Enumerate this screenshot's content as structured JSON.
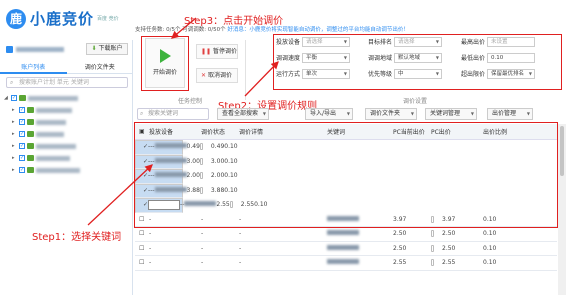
{
  "app": {
    "name": "小鹿竞价",
    "sub": "百度\n竞价"
  },
  "sidebar": {
    "download_btn": "下载账户",
    "tabs": [
      "账户列表",
      "调价文件夹"
    ],
    "search_placeholder": "搜索账户计划 单元 关键词",
    "tree_count": 6
  },
  "ribbon": {
    "hint_prefix": "支持任务数: 0/5个  可调调数: 0/50个",
    "hint_blue": "好消息：小鹿竞价将实现智能自动调价，调整过的平台均能自动调节出价！",
    "start_label": "开始调价",
    "pause_label": "暂停调价",
    "cancel_label": "取消调价",
    "section1": "任务控制",
    "section2": "调价设置",
    "settings": {
      "device": {
        "label": "投放设备",
        "value": "请选择"
      },
      "target_rank": {
        "label": "目标排名",
        "value": "请选择"
      },
      "max_price": {
        "label": "最高出价",
        "value": "未设置"
      },
      "speed": {
        "label": "调调速度",
        "value": "平衡"
      },
      "region": {
        "label": "调调地域",
        "value": "默认地域"
      },
      "min_price": {
        "label": "最低出价",
        "value": "0.10"
      },
      "mode": {
        "label": "运行方式",
        "value": "单次"
      },
      "priority": {
        "label": "优先等级",
        "value": "中"
      },
      "over_price": {
        "label": "超出限价",
        "value": "保留最优排名"
      }
    }
  },
  "annotations": {
    "step1": "Step1：选择关键词",
    "step2": "Step2：设置调价规则",
    "step3": "Step3：点击开始调价"
  },
  "toolbar": {
    "search_placeholder": "搜索关键词",
    "btn1": "查看全部搜索",
    "btn2": "导入/导出",
    "btn3": "调价文件夹",
    "btn4": "关键词管理",
    "btn5": "出价管理"
  },
  "table": {
    "headers": [
      "",
      "投放设备",
      "调价状态",
      "调价详情",
      "关键词",
      "PC当前出价",
      "PC出价",
      "出价比例"
    ],
    "rows": [
      {
        "sel": true,
        "device": "-",
        "status": "-",
        "detail": "-",
        "pc_cur": "0.49",
        "pc": "0.49",
        "ratio": "0.10"
      },
      {
        "sel": true,
        "device": "-",
        "status": "-",
        "detail": "-",
        "pc_cur": "3.00",
        "pc": "3.00",
        "ratio": "0.10"
      },
      {
        "sel": true,
        "device": "-",
        "status": "-",
        "detail": "-",
        "pc_cur": "2.00",
        "pc": "2.00",
        "ratio": "0.10"
      },
      {
        "sel": true,
        "device": "-",
        "status": "-",
        "detail": "-",
        "pc_cur": "3.88",
        "pc": "3.88",
        "ratio": "0.10"
      },
      {
        "sel": true,
        "device": "-",
        "status": "-",
        "detail": "-",
        "pc_cur": "2.55",
        "pc": "2.55",
        "ratio": "0.10"
      },
      {
        "sel": false,
        "device": "-",
        "status": "-",
        "detail": "-",
        "pc_cur": "3.97",
        "pc": "3.97",
        "ratio": "0.10"
      },
      {
        "sel": false,
        "device": "-",
        "status": "-",
        "detail": "-",
        "pc_cur": "2.50",
        "pc": "2.50",
        "ratio": "0.10"
      },
      {
        "sel": false,
        "device": "-",
        "status": "-",
        "detail": "-",
        "pc_cur": "2.50",
        "pc": "2.50",
        "ratio": "0.10"
      },
      {
        "sel": false,
        "device": "-",
        "status": "-",
        "detail": "-",
        "pc_cur": "2.55",
        "pc": "2.55",
        "ratio": "0.10"
      }
    ]
  },
  "colors": {
    "accent": "#2d8cf0",
    "annotation": "#e02020",
    "selected_row": "#c7dcf2"
  }
}
